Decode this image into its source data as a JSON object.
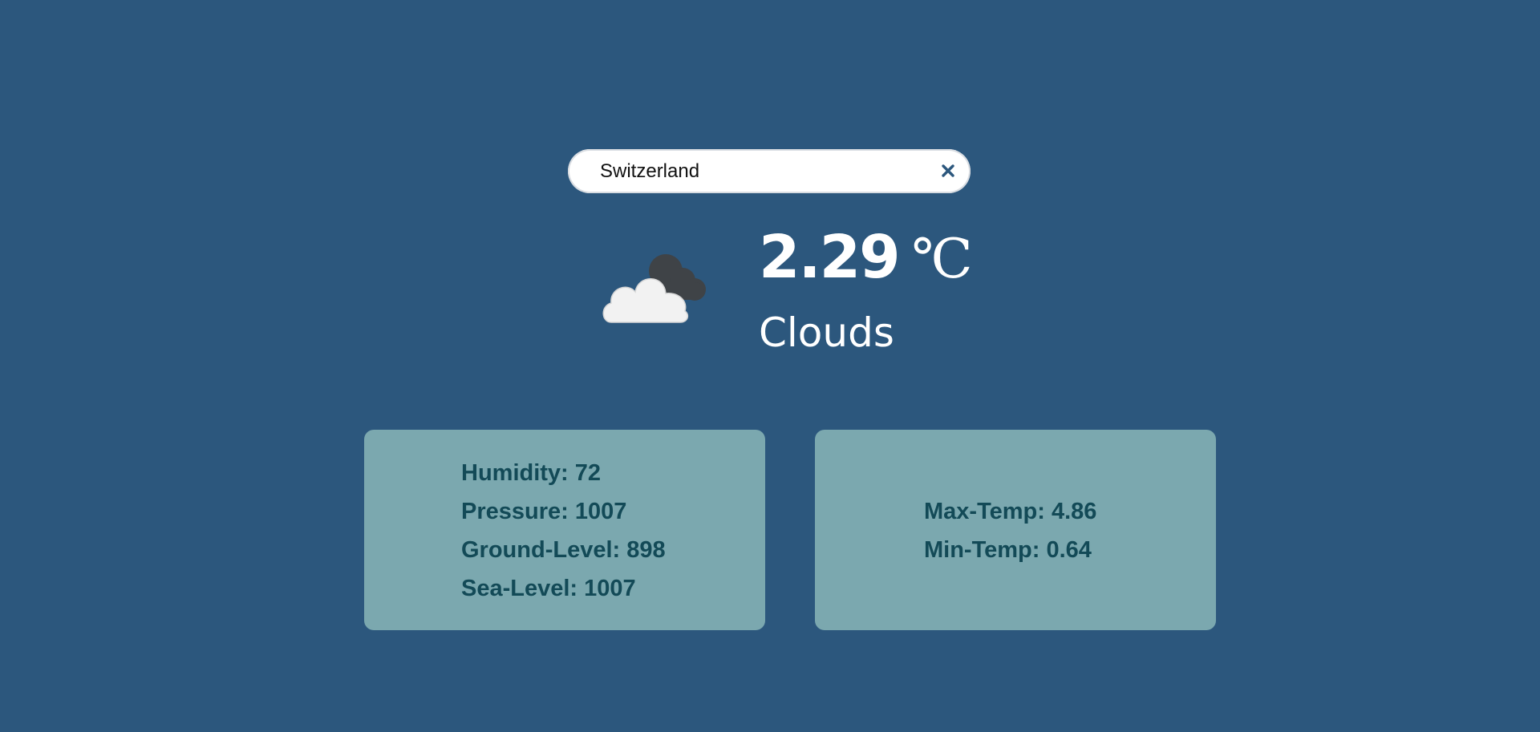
{
  "search": {
    "value": "Switzerland",
    "clear_glyph": "×"
  },
  "weather": {
    "icon": "clouds-icon",
    "temperature": "2.29",
    "unit": "℃",
    "condition": "Clouds"
  },
  "details_left": {
    "humidity": "Humidity: 72",
    "pressure": "Pressure: 1007",
    "ground_level": "Ground-Level: 898",
    "sea_level": "Sea-Level: 1007"
  },
  "details_right": {
    "max_temp": "Max-Temp: 4.86",
    "min_temp": "Min-Temp: 0.64"
  },
  "colors": {
    "background": "#2c577d",
    "card": "#7ba8af",
    "card_text": "#134a57",
    "clear_icon": "#2c577d"
  }
}
